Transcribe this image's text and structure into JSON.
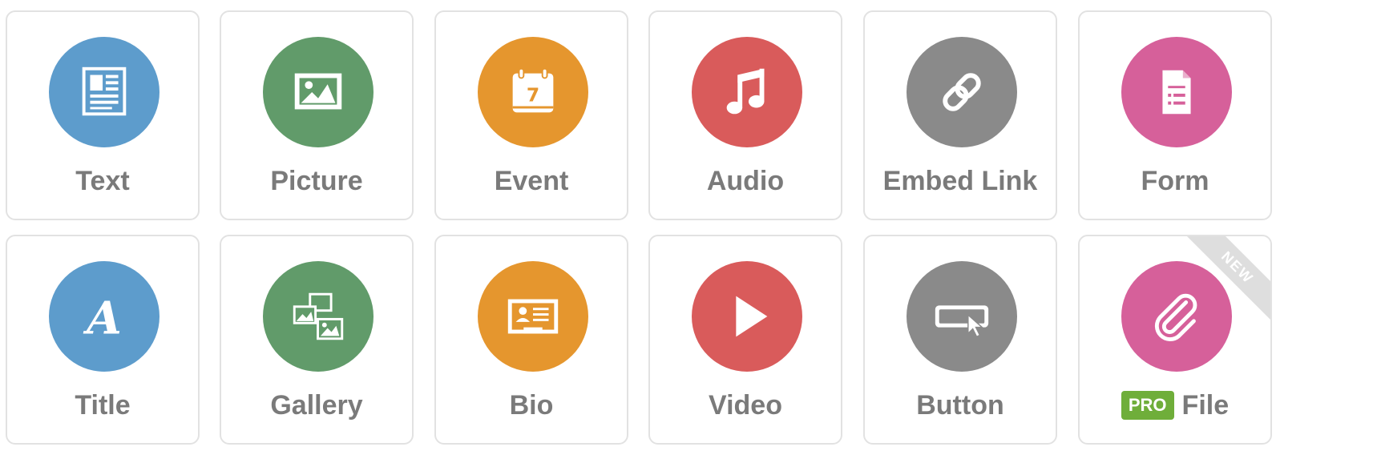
{
  "colors": {
    "blue": "#5d9ccc",
    "green": "#619b6a",
    "orange": "#e5962e",
    "red": "#d95b5b",
    "gray": "#8a8a8a",
    "pink": "#d6609a",
    "label": "#7a7a7a",
    "pro_badge": "#6fae3a"
  },
  "tiles": [
    {
      "label": "Text",
      "icon": "text-document-icon",
      "color": "blue"
    },
    {
      "label": "Picture",
      "icon": "picture-icon",
      "color": "green"
    },
    {
      "label": "Event",
      "icon": "calendar-icon",
      "color": "orange"
    },
    {
      "label": "Audio",
      "icon": "music-note-icon",
      "color": "red"
    },
    {
      "label": "Embed Link",
      "icon": "link-icon",
      "color": "gray"
    },
    {
      "label": "Form",
      "icon": "form-icon",
      "color": "pink"
    },
    {
      "label": "Title",
      "icon": "title-letter-icon",
      "color": "blue"
    },
    {
      "label": "Gallery",
      "icon": "gallery-icon",
      "color": "green"
    },
    {
      "label": "Bio",
      "icon": "bio-card-icon",
      "color": "orange"
    },
    {
      "label": "Video",
      "icon": "play-icon",
      "color": "red"
    },
    {
      "label": "Button",
      "icon": "button-cursor-icon",
      "color": "gray"
    },
    {
      "label": "File",
      "icon": "paperclip-icon",
      "color": "pink",
      "badge": "PRO",
      "ribbon": "NEW"
    }
  ],
  "calendar_day": "7"
}
